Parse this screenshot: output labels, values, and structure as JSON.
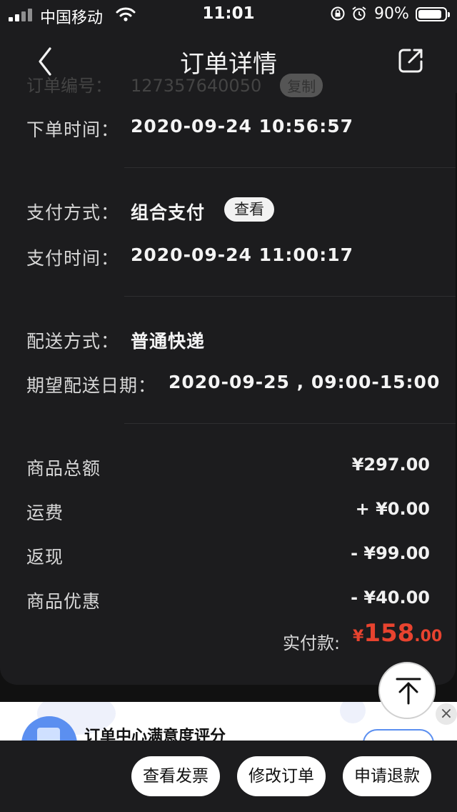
{
  "status_bar": {
    "carrier": "中国移动",
    "time": "11:01",
    "battery_percent": "90%",
    "battery_level": 0.9
  },
  "nav": {
    "title": "订单详情",
    "back_icon": "chevron-left-icon",
    "share_icon": "share-icon"
  },
  "order": {
    "ghost_label": "订单编号：",
    "ghost_number": "127357640050",
    "ghost_copy": "复制",
    "order_time_label": "下单时间：",
    "order_time": "2020-09-24 10:56:57",
    "pay_method_label": "支付方式：",
    "pay_method": "组合支付",
    "pay_view": "查看",
    "pay_time_label": "支付时间：",
    "pay_time": "2020-09-24 11:00:17",
    "ship_method_label": "配送方式：",
    "ship_method": "普通快递",
    "ship_date_label": "期望配送日期：",
    "ship_date": "2020-09-25 , 09:00-15:00"
  },
  "amounts": [
    {
      "label": "商品总额",
      "value": "¥297.00"
    },
    {
      "label": "运费",
      "value": "+ ¥0.00"
    },
    {
      "label": "返现",
      "value": "- ¥99.00"
    },
    {
      "label": "商品优惠",
      "value": "- ¥40.00"
    }
  ],
  "total": {
    "label": "实付款:",
    "symbol": "¥",
    "integer": "158",
    "decimal": ".00",
    "color": "#e8432f"
  },
  "banner": {
    "title": "订单中心满意度评分",
    "close": "×"
  },
  "actions": {
    "invoice": "查看发票",
    "modify": "修改订单",
    "refund": "申请退款"
  }
}
